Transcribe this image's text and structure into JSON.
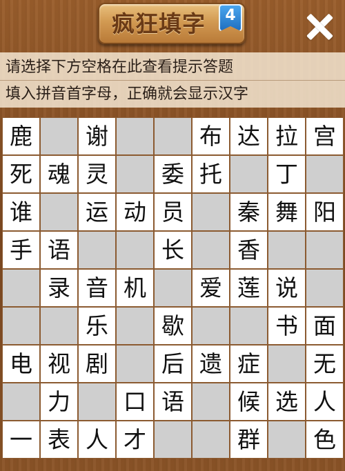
{
  "header": {
    "title": "疯狂填字",
    "level": "4",
    "close_icon": "close-icon"
  },
  "hint": {
    "line1": "请选择下方空格在此查看提示答题",
    "line2": "填入拼音首字母，正确就会显示汉字"
  },
  "colors": {
    "board_bg": "#8b5a30",
    "cell_white": "#ffffff",
    "cell_gray": "#cfcfcf",
    "badge_blue": "#2f86d6"
  },
  "grid": {
    "rows": 9,
    "cols": 9,
    "cells": [
      [
        "鹿",
        null,
        "谢",
        null,
        null,
        "布",
        "达",
        "拉",
        "宫"
      ],
      [
        "死",
        "魂",
        "灵",
        null,
        "委",
        "托",
        null,
        "丁",
        null
      ],
      [
        "谁",
        null,
        "运",
        "动",
        "员",
        null,
        "秦",
        "舞",
        "阳"
      ],
      [
        "手",
        "语",
        null,
        null,
        "长",
        null,
        "香",
        null,
        null
      ],
      [
        null,
        "录",
        "音",
        "机",
        null,
        "爱",
        "莲",
        "说",
        null
      ],
      [
        null,
        null,
        "乐",
        null,
        "歇",
        null,
        null,
        "书",
        "面"
      ],
      [
        "电",
        "视",
        "剧",
        null,
        "后",
        "遗",
        "症",
        null,
        "无"
      ],
      [
        null,
        "力",
        null,
        "口",
        "语",
        null,
        "候",
        "选",
        "人"
      ],
      [
        "一",
        "表",
        "人",
        "才",
        null,
        null,
        "群",
        null,
        "色"
      ]
    ]
  }
}
